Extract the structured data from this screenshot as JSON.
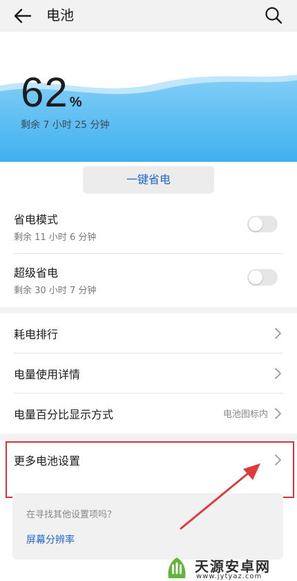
{
  "header": {
    "title": "电池",
    "back_icon": "arrow-left-icon",
    "search_icon": "search-icon"
  },
  "battery": {
    "percent": "62",
    "unit": "%",
    "remaining": "剩余 7 小时 25 分钟",
    "wave_color": "#4fb6f2"
  },
  "one_tap_save": {
    "label": "一键省电"
  },
  "modes": [
    {
      "title": "省电模式",
      "subtitle": "剩余 11 小时 6 分钟",
      "enabled": false
    },
    {
      "title": "超级省电",
      "subtitle": "剩余 30 小时 7 分钟",
      "enabled": false
    }
  ],
  "menu": [
    {
      "label": "耗电排行",
      "value": ""
    },
    {
      "label": "电量使用详情",
      "value": ""
    },
    {
      "label": "电量百分比显示方式",
      "value": "电池图标内"
    }
  ],
  "more": {
    "label": "更多电池设置"
  },
  "suggestion": {
    "question": "在寻找其他设置项吗？",
    "link": "屏幕分辨率"
  },
  "annotation": {
    "highlight_color": "#d8323a"
  },
  "watermark": {
    "name": "天源安卓网",
    "url": "www.jytyaz.com"
  },
  "colors": {
    "accent": "#1e66c9",
    "background": "#f2f2f2"
  }
}
